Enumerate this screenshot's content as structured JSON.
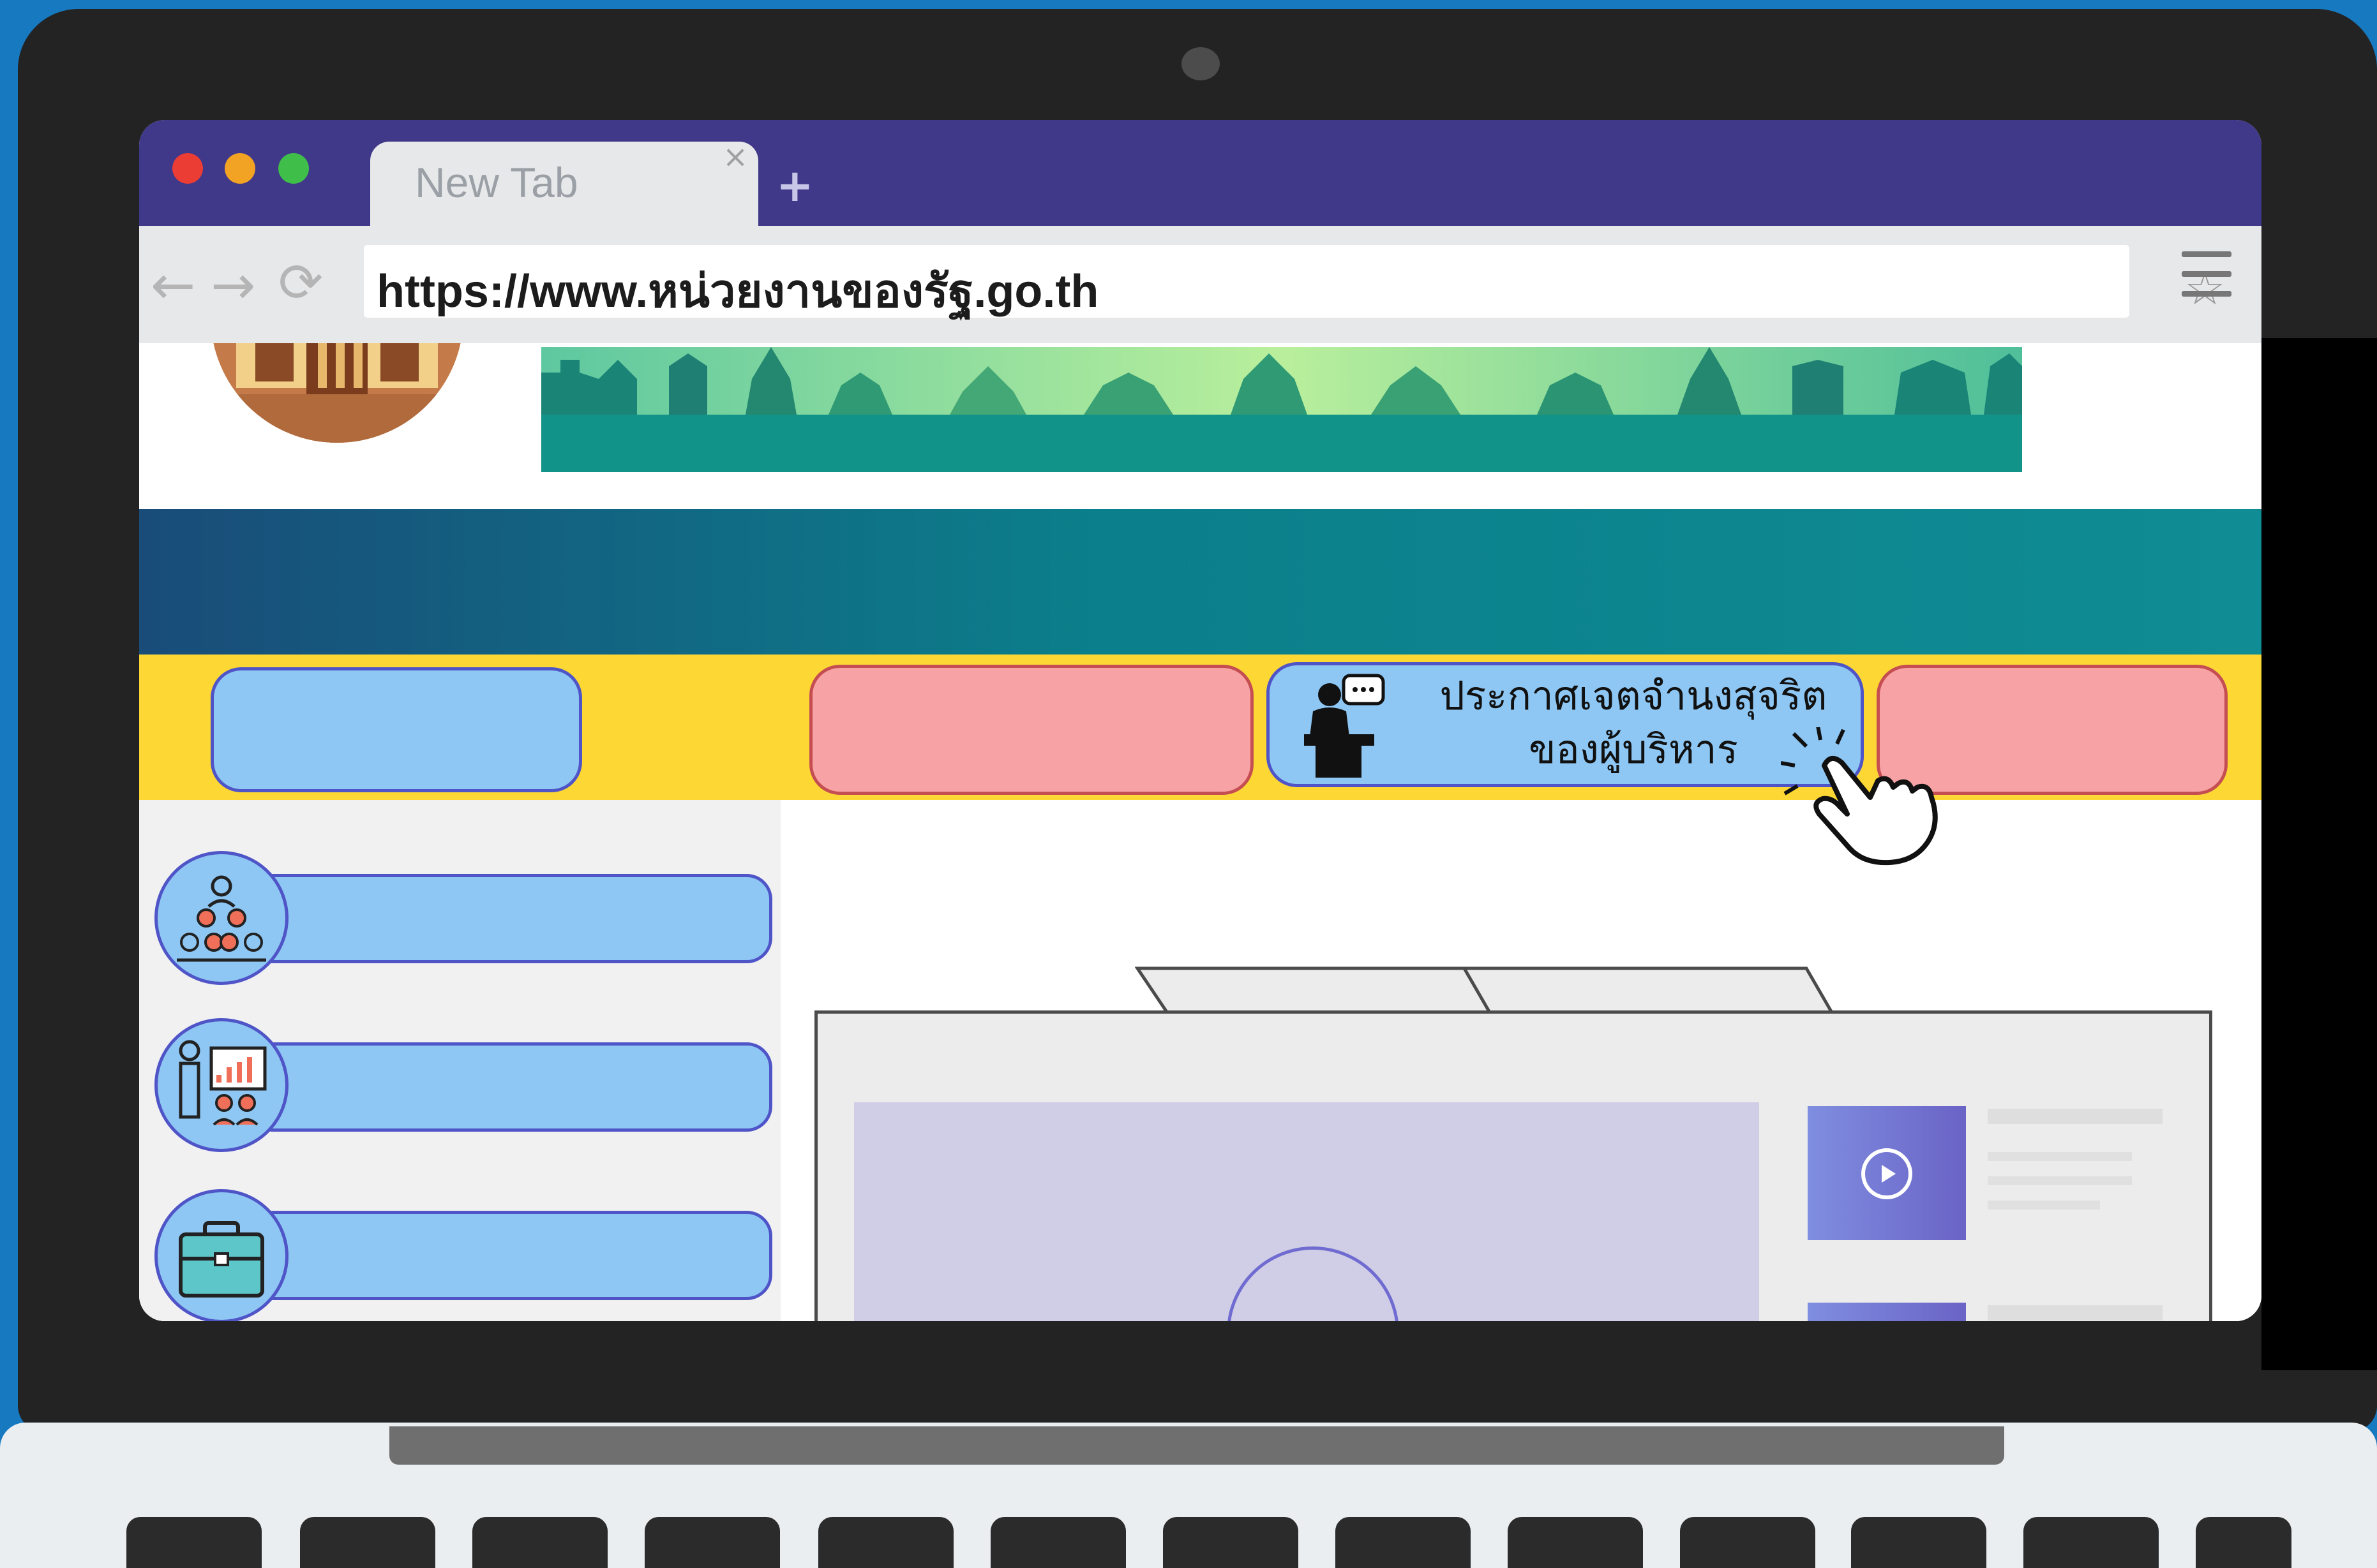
{
  "browser": {
    "tab_title": "New Tab",
    "tab_close": "×",
    "new_tab": "+",
    "url": "https://www.หน่วยงานของรัฐ.go.th",
    "nav": {
      "back": "←",
      "forward": "→",
      "reload": "⟳"
    },
    "bookmark": "☆"
  },
  "page": {
    "announcement_button_label": "ประกาศเจตจำนงสุจริต ของผู้บริหาร"
  },
  "icons": {
    "traffic_lights": [
      "close-dot",
      "minimize-dot",
      "maximize-dot"
    ],
    "sidebar": [
      "people-hierarchy-icon",
      "presenter-chart-icon",
      "briefcase-icon"
    ],
    "announcement": "speaker-podium-icon",
    "cursor": "hand-pointer-icon",
    "play": "play-icon"
  },
  "colors": {
    "titlebar": "#403889",
    "teal_band": "#0f8c94",
    "nav_bar": "#fdd835",
    "pill_blue": "#8ec7f4",
    "pill_pink": "#f7a3a5"
  }
}
